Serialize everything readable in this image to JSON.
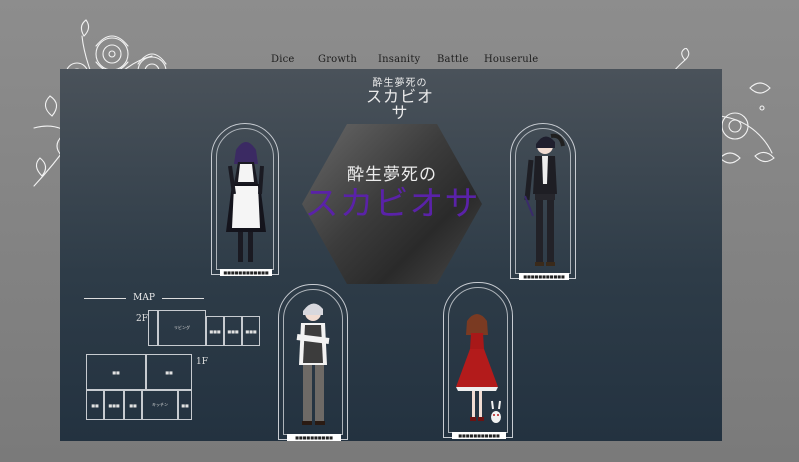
{
  "nav": {
    "items": [
      "Dice",
      "Growth",
      "Insanity",
      "Battle",
      "Houserule"
    ]
  },
  "logo": {
    "line1": "酔生夢死の",
    "line2": "スカビオサ"
  },
  "hero": {
    "line1": "酔生夢死の",
    "line2": "スカビオサ"
  },
  "characters": [
    {
      "plate": "■■■■■■■■■■■■"
    },
    {
      "plate": "■■■■■■■■■■■"
    },
    {
      "plate": "■■■■■■■■■■"
    },
    {
      "plate": "■■■■■■■■■■■"
    }
  ],
  "map": {
    "label": "MAP",
    "floors": {
      "f2": "2F",
      "f1": "1F"
    },
    "rooms2f": [
      "リビング",
      "■■■",
      "■■■",
      "■■■",
      "■■■"
    ],
    "rooms1f": [
      "■■",
      "■■",
      "■■",
      "■■■",
      "■■",
      "キッチン",
      "■■"
    ]
  },
  "colors": {
    "accent": "#5a22a8",
    "panel": "#2e3c48"
  }
}
